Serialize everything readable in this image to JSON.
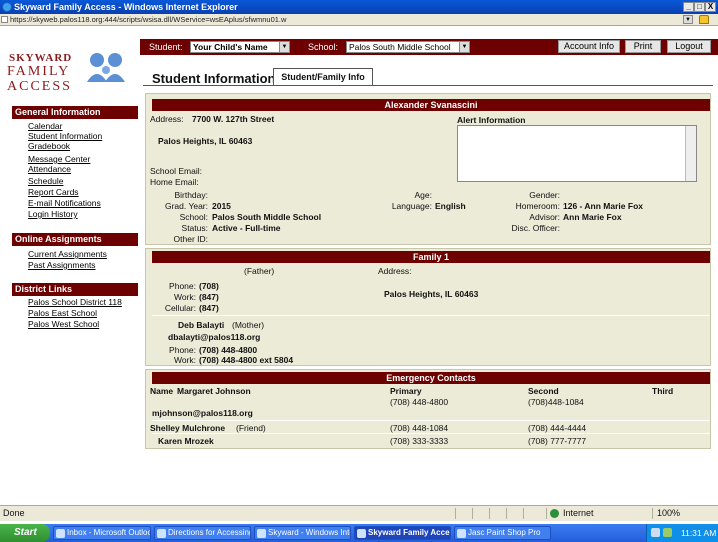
{
  "window": {
    "title": "Skyward Family Access - Windows Internet Explorer",
    "url": "https://skyweb.palos118.org:444/scripts/wsisa.dll/WService=wsEAplus/sfwmnu01.w",
    "min": "_",
    "max": "□",
    "close": "X"
  },
  "topnav": {
    "student_label": "Student:",
    "student_value": "Your Child's Name",
    "school_label": "School:",
    "school_value": "Palos South Middle School",
    "account_info": "Account Info",
    "print": "Print",
    "logout": "Logout"
  },
  "logo": {
    "line1": "SKYWARD",
    "line2": "FAMILY",
    "line3": "ACCESS"
  },
  "sidebar": {
    "general_header": "General Information",
    "general_links": [
      "Calendar",
      "Student Information",
      "Gradebook",
      "Message Center",
      "Attendance",
      "Schedule",
      "Report Cards",
      "E-mail Notifications",
      "Login History"
    ],
    "online_header": "Online Assignments",
    "online_links": [
      "Current Assignments",
      "Past Assignments"
    ],
    "district_header": "District Links",
    "district_links": [
      "Palos School District 118",
      "Palos East School",
      "Palos West School"
    ]
  },
  "page": {
    "title": "Student Information",
    "tab": "Student/Family Info"
  },
  "student": {
    "name": "Alexander Svanascini",
    "address_label": "Address:",
    "address_line1": "7700 W. 127th Street",
    "address_line2": "Palos Heights, IL 60463",
    "alert_title": "Alert Information",
    "school_email_label": "School Email:",
    "home_email_label": "Home Email:",
    "birthday_label": "Birthday:",
    "grad_year_label": "Grad. Year:",
    "grad_year": "2015",
    "school_label": "School:",
    "school": "Palos South Middle School",
    "status_label": "Status:",
    "status": "Active - Full-time",
    "other_id_label": "Other ID:",
    "age_label": "Age:",
    "language_label": "Language:",
    "language": "English",
    "gender_label": "Gender:",
    "homeroom_label": "Homeroom:",
    "homeroom": "126 - Ann Marie Fox",
    "advisor_label": "Advisor:",
    "advisor": "Ann Marie Fox",
    "disc_officer_label": "Disc. Officer:"
  },
  "family": {
    "header": "Family 1",
    "father_role": "(Father)",
    "address_label": "Address:",
    "father_address": "Palos Heights, IL 60463",
    "phone_label": "Phone:",
    "work_label": "Work:",
    "cellular_label": "Cellular:",
    "father_phone": "(708)",
    "father_work": "(847)",
    "father_cell": "(847)",
    "mother_name": "Deb Balayti",
    "mother_role": "(Mother)",
    "mother_email": "dbalayti@palos118.org",
    "mother_phone": "(708) 448-4800",
    "mother_work": "(708) 448-4800 ext 5804"
  },
  "emergency": {
    "header": "Emergency Contacts",
    "col_name": "Name",
    "col_primary": "Primary",
    "col_second": "Second",
    "col_third": "Third",
    "rows": [
      {
        "name": "Margaret Johnson",
        "extra": "mjohnson@palos118.org",
        "primary": "(708) 448-4800",
        "second": "(708)448-1084"
      },
      {
        "name": "Shelley Mulchrone",
        "extra": "(Friend)",
        "primary": "(708) 448-1084",
        "second": "(708) 444-4444"
      },
      {
        "name": "Karen Mrozek",
        "extra": "",
        "primary": "(708) 333-3333",
        "second": "(708) 777-7777"
      }
    ]
  },
  "statusbar": {
    "left": "Done",
    "zone": "Internet",
    "zoom": "100%"
  },
  "taskbar": {
    "start": "Start",
    "tasks": [
      "Inbox - Microsoft Outlook",
      "Directions for Accessing ...",
      "Skyward - Windows Inte...",
      "Skyward Family Acce...",
      "Jasc Paint Shop Pro"
    ],
    "clock": "11:31 AM"
  }
}
